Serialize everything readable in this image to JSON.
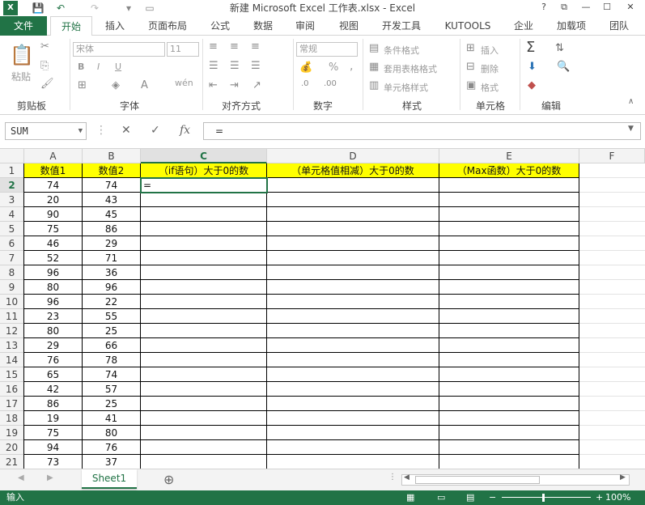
{
  "window": {
    "title": "新建 Microsoft Excel 工作表.xlsx - Excel",
    "help": "?",
    "restore": "⧉",
    "minimize": "—",
    "maximize": "☐",
    "close": "✕"
  },
  "tabs": {
    "file": "文件",
    "home": "开始",
    "insert": "插入",
    "layout": "页面布局",
    "formulas": "公式",
    "data": "数据",
    "review": "审阅",
    "view": "视图",
    "developer": "开发工具",
    "kutools": "KUTOOLS",
    "enterprise": "企业",
    "addins": "加载项",
    "team": "团队"
  },
  "ribbon": {
    "paste": "粘贴",
    "clipboard": "剪贴板",
    "font_name": "宋体",
    "font_size": "11",
    "bold": "B",
    "italic": "I",
    "underline": "U",
    "font_group": "字体",
    "wrap": "wén",
    "align_group": "对齐方式",
    "number_format": "常规",
    "percent": "%",
    "comma": ",",
    "number_group": "数字",
    "cond_format": "条件格式",
    "table_format": "套用表格格式",
    "cell_style": "单元格样式",
    "styles_group": "样式",
    "insert": "插入",
    "delete": "删除",
    "format": "格式",
    "cells_group": "单元格",
    "sum": "Σ",
    "edit_group": "编辑"
  },
  "formula_bar": {
    "name_box": "SUM",
    "cancel": "✕",
    "enter": "✓",
    "fx": "fx",
    "content": "="
  },
  "columns": [
    "A",
    "B",
    "C",
    "D",
    "E",
    "F"
  ],
  "headers": {
    "a": "数值1",
    "b": "数值2",
    "c": "（if语句）大于0的数",
    "d": "（单元格值相减）大于0的数",
    "e": "（Max函数）大于0的数"
  },
  "rows": [
    {
      "n": "1"
    },
    {
      "n": "2",
      "a": "74",
      "b": "74",
      "c": "="
    },
    {
      "n": "3",
      "a": "20",
      "b": "43"
    },
    {
      "n": "4",
      "a": "90",
      "b": "45"
    },
    {
      "n": "5",
      "a": "75",
      "b": "86"
    },
    {
      "n": "6",
      "a": "46",
      "b": "29"
    },
    {
      "n": "7",
      "a": "52",
      "b": "71"
    },
    {
      "n": "8",
      "a": "96",
      "b": "36"
    },
    {
      "n": "9",
      "a": "80",
      "b": "96"
    },
    {
      "n": "10",
      "a": "96",
      "b": "22"
    },
    {
      "n": "11",
      "a": "23",
      "b": "55"
    },
    {
      "n": "12",
      "a": "80",
      "b": "25"
    },
    {
      "n": "13",
      "a": "29",
      "b": "66"
    },
    {
      "n": "14",
      "a": "76",
      "b": "78"
    },
    {
      "n": "15",
      "a": "65",
      "b": "74"
    },
    {
      "n": "16",
      "a": "42",
      "b": "57"
    },
    {
      "n": "17",
      "a": "86",
      "b": "25"
    },
    {
      "n": "18",
      "a": "19",
      "b": "41"
    },
    {
      "n": "19",
      "a": "75",
      "b": "80"
    },
    {
      "n": "20",
      "a": "94",
      "b": "76"
    },
    {
      "n": "21",
      "a": "73",
      "b": "37"
    }
  ],
  "sheets": {
    "active": "Sheet1",
    "add": "⊕"
  },
  "status": {
    "mode": "输入",
    "zoom": "100%"
  },
  "colors": {
    "excel_green": "#217346",
    "header_fill": "#ffff00"
  }
}
